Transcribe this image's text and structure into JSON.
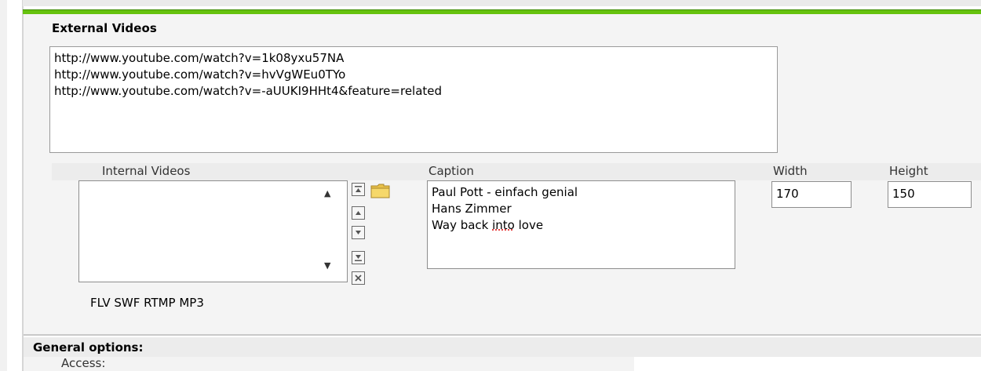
{
  "external_videos": {
    "title": "External Videos",
    "urls": [
      "http://www.youtube.com/watch?v=1k08yxu57NA",
      "http://www.youtube.com/watch?v=hvVgWEu0TYo",
      "http://www.youtube.com/watch?v=-aUUKI9HHt4&feature=related"
    ]
  },
  "columns": {
    "internal_videos": "Internal Videos",
    "caption": "Caption",
    "width": "Width",
    "height": "Height"
  },
  "internal_videos": {
    "items": [],
    "formats": "FLV SWF RTMP MP3"
  },
  "captions": [
    {
      "pre": "Paul Pott - einfach genial",
      "word": "",
      "post": ""
    },
    {
      "pre": "Hans Zimmer",
      "word": "",
      "post": ""
    },
    {
      "pre": "Way back ",
      "word": "into",
      "post": " love"
    }
  ],
  "width_value": "170",
  "height_value": "150",
  "general_options": {
    "title": "General options:",
    "access_label": "Access:"
  },
  "colors": {
    "accent_green": "#66c20e"
  },
  "icons": [
    "move-top-icon",
    "move-up-icon",
    "move-down-icon",
    "move-bottom-icon",
    "remove-icon",
    "folder-icon"
  ]
}
